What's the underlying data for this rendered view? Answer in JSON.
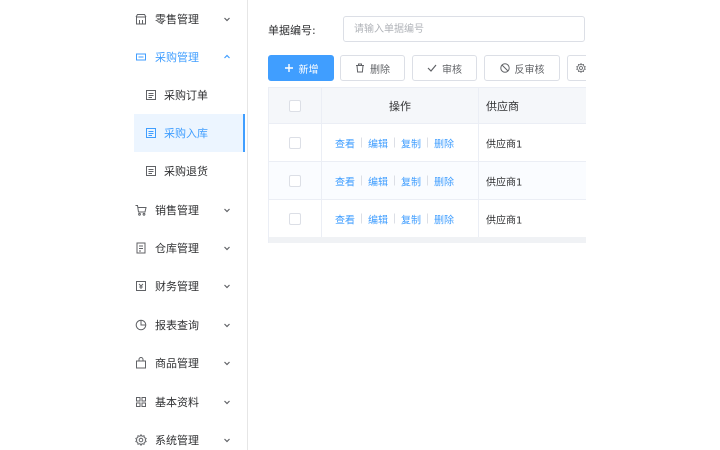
{
  "sidebar": {
    "items": [
      {
        "label": "零售管理",
        "icon": "shop-icon"
      },
      {
        "label": "采购管理",
        "icon": "purchase-icon",
        "open": true,
        "children": [
          {
            "label": "采购订单",
            "icon": "document-icon"
          },
          {
            "label": "采购入库",
            "icon": "document-icon",
            "active": true
          },
          {
            "label": "采购退货",
            "icon": "document-icon"
          }
        ]
      },
      {
        "label": "销售管理",
        "icon": "cart-icon"
      },
      {
        "label": "仓库管理",
        "icon": "warehouse-icon"
      },
      {
        "label": "财务管理",
        "icon": "finance-icon"
      },
      {
        "label": "报表查询",
        "icon": "pie-chart-icon"
      },
      {
        "label": "商品管理",
        "icon": "goods-icon"
      },
      {
        "label": "基本资料",
        "icon": "grid-icon"
      },
      {
        "label": "系统管理",
        "icon": "gear-icon"
      }
    ],
    "accent_color": "#409eff"
  },
  "search": {
    "label": "单据编号:",
    "placeholder": "请输入单据编号",
    "value": ""
  },
  "toolbar": {
    "add_label": "新增",
    "delete_label": "删除",
    "audit_label": "审核",
    "unaudit_label": "反审核"
  },
  "table": {
    "headers": {
      "operations": "操作",
      "supplier": "供应商"
    },
    "rows": [
      {
        "actions": [
          "查看",
          "编辑",
          "复制",
          "删除"
        ],
        "supplier": "供应商1"
      },
      {
        "actions": [
          "查看",
          "编辑",
          "复制",
          "删除"
        ],
        "supplier": "供应商1"
      },
      {
        "actions": [
          "查看",
          "编辑",
          "复制",
          "删除"
        ],
        "supplier": "供应商1"
      }
    ]
  }
}
